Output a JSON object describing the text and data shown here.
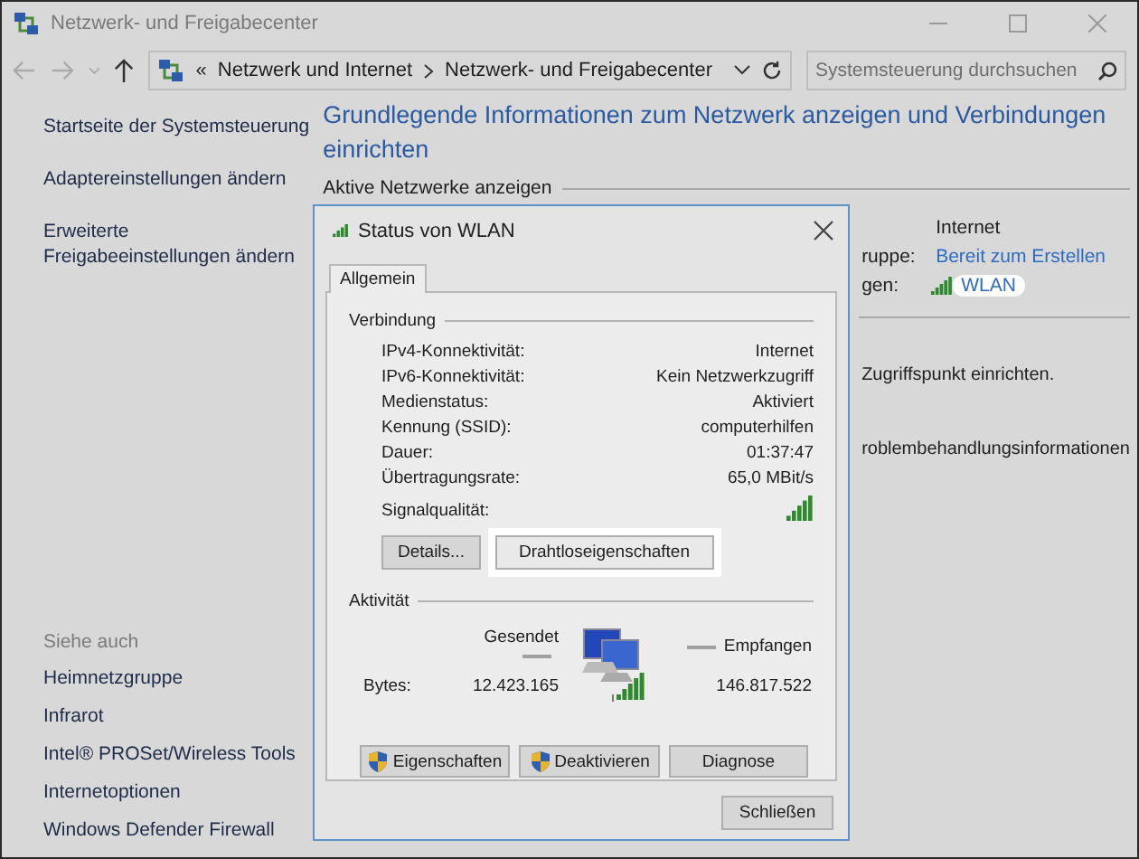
{
  "window": {
    "title": "Netzwerk- und Freigabecenter"
  },
  "address_bar": {
    "overflow_marker": "«",
    "breadcrumbs": [
      "Netzwerk und Internet",
      "Netzwerk- und Freigabecenter"
    ]
  },
  "search": {
    "placeholder": "Systemsteuerung durchsuchen"
  },
  "sidebar": {
    "links": [
      "Startseite der Systemsteuerung",
      "Adaptereinstellungen ändern",
      "Erweiterte Freigabeeinstellungen ändern"
    ],
    "see_also_heading": "Siehe auch",
    "see_also": [
      "Heimnetzgruppe",
      "Infrarot",
      "Intel® PROSet/Wireless Tools",
      "Internetoptionen",
      "Windows Defender Firewall"
    ]
  },
  "main": {
    "heading": "Grundlegende Informationen zum Netzwerk anzeigen und Verbindungen einrichten",
    "section": "Aktive Netzwerke anzeigen",
    "rows": [
      {
        "kind": "text",
        "label": "",
        "value": "Internet",
        "highlighted": false
      },
      {
        "kind": "link",
        "label": "ruppe:",
        "value": "Bereit zum Erstellen",
        "highlighted": false
      },
      {
        "kind": "connection",
        "label": "gen:",
        "value": "WLAN",
        "highlighted": true
      }
    ],
    "fragments": [
      "Zugriffspunkt einrichten.",
      "roblembehandlungsinformationen"
    ]
  },
  "dialog": {
    "title": "Status von WLAN",
    "tabs": [
      {
        "label": "Allgemein",
        "selected": true
      }
    ],
    "connection": {
      "heading": "Verbindung",
      "rows": [
        {
          "label": "IPv4-Konnektivität:",
          "value": "Internet"
        },
        {
          "label": "IPv6-Konnektivität:",
          "value": "Kein Netzwerkzugriff"
        },
        {
          "label": "Medienstatus:",
          "value": "Aktiviert"
        },
        {
          "label": "Kennung (SSID):",
          "value": "computerhilfen"
        },
        {
          "label": "Dauer:",
          "value": "01:37:47"
        },
        {
          "label": "Übertragungsrate:",
          "value": "65,0 MBit/s"
        }
      ],
      "signal_label": "Signalqualität:",
      "buttons": [
        {
          "label": "Details...",
          "highlighted": false
        },
        {
          "label": "Drahtloseigenschaften",
          "highlighted": true
        }
      ]
    },
    "activity": {
      "heading": "Aktivität",
      "sent_label": "Gesendet",
      "received_label": "Empfangen",
      "bytes_label": "Bytes:",
      "sent": "12.423.165",
      "received": "146.817.522",
      "buttons": [
        {
          "label": "Eigenschaften",
          "shield": true
        },
        {
          "label": "Deaktivieren",
          "shield": true
        },
        {
          "label": "Diagnose",
          "shield": false
        }
      ]
    },
    "close_button": "Schließen"
  }
}
